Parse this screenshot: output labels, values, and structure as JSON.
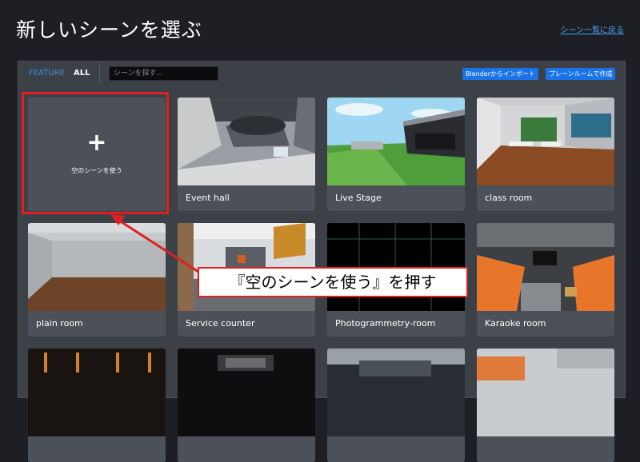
{
  "header": {
    "title": "新しいシーンを選ぶ",
    "back_link": "シーン一覧に戻る"
  },
  "toolbar": {
    "tab_feature": "FEATURE",
    "tab_all": "ALL",
    "search_placeholder": "シーンを探す...",
    "import_button": "Blenderからインポート",
    "plain_room_button": "プレーンルームで作成"
  },
  "new_scene": {
    "label": "空のシーンを使う",
    "plus": "+"
  },
  "scenes": [
    {
      "label": "Event hall"
    },
    {
      "label": "Live Stage"
    },
    {
      "label": "class room"
    },
    {
      "label": "plain room"
    },
    {
      "label": "Service counter"
    },
    {
      "label": "Photogrammetry-room"
    },
    {
      "label": "Karaoke room"
    }
  ],
  "annotation": {
    "callout": "『空のシーンを使う』を押す"
  },
  "colors": {
    "accent": "#1a73e8",
    "highlight": "#e02020",
    "panel": "#3c4047",
    "background": "#1d1f24"
  }
}
